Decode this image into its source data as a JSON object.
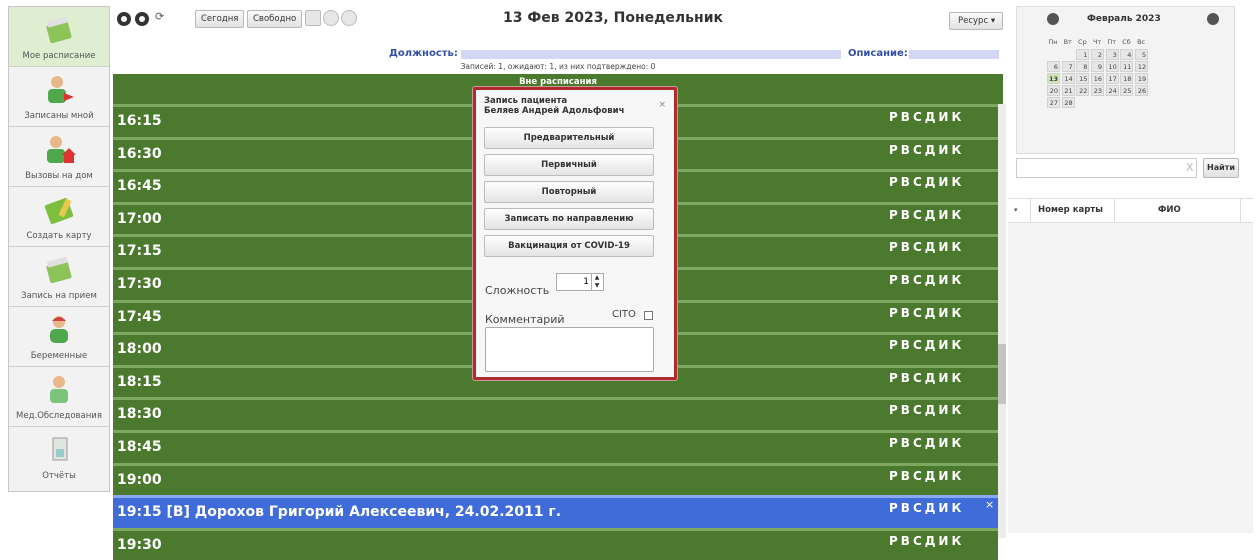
{
  "sidebar": {
    "items": [
      {
        "label": "Мое расписание",
        "icon": "calendar-icon"
      },
      {
        "label": "Записаны мной",
        "icon": "patient-arrow-icon"
      },
      {
        "label": "Вызовы на дом",
        "icon": "house-call-icon"
      },
      {
        "label": "Создать карту",
        "icon": "card-icon"
      },
      {
        "label": "Запись на прием",
        "icon": "calendar-icon"
      },
      {
        "label": "Беременные",
        "icon": "pregnant-icon"
      },
      {
        "label": "Мед.Обследования",
        "icon": "patient-icon"
      },
      {
        "label": "Отчёты",
        "icon": "report-icon"
      }
    ]
  },
  "toolbar": {
    "today_label": "Сегодня",
    "free_label": "Свободно",
    "date_title": "13 Фев 2023, Понедельник",
    "resource_label": "Ресурс"
  },
  "info": {
    "position_label": "Должность:",
    "description_label": "Описание:",
    "summary": "Записей: 1, ожидают: 1, из них подтверждено: 0",
    "outside_schedule": "Вне расписания"
  },
  "schedule": {
    "slot_codes": "РВСДИК",
    "slots": [
      {
        "time": "16:15"
      },
      {
        "time": "16:30"
      },
      {
        "time": "16:45"
      },
      {
        "time": "17:00"
      },
      {
        "time": "17:15"
      },
      {
        "time": "17:30"
      },
      {
        "time": "17:45"
      },
      {
        "time": "18:00"
      },
      {
        "time": "18:15"
      },
      {
        "time": "18:30"
      },
      {
        "time": "18:45"
      },
      {
        "time": "19:00"
      },
      {
        "time": "19:15 [В] Дорохов Григорий Алексеевич, 24.02.2011 г.",
        "booked": true
      },
      {
        "time": "19:30"
      }
    ]
  },
  "dialog": {
    "title_line1": "Запись пациента",
    "title_line2": "Беляев Андрей Адольфович",
    "close": "×",
    "buttons": [
      "Предварительный",
      "Первичный",
      "Повторный",
      "Записать по направлению",
      "Вакцинация от COVID-19"
    ],
    "complexity_label": "Сложность",
    "complexity_value": "1",
    "comment_label": "Комментарий",
    "cito_label": "CITO"
  },
  "calendar": {
    "month": "Февраль 2023",
    "weekdays": [
      "Пн",
      "Вт",
      "Ср",
      "Чт",
      "Пт",
      "Сб",
      "Вс"
    ],
    "weeks": [
      [
        "",
        "",
        "1",
        "2",
        "3",
        "4",
        "5"
      ],
      [
        "6",
        "7",
        "8",
        "9",
        "10",
        "11",
        "12"
      ],
      [
        "13",
        "14",
        "15",
        "16",
        "17",
        "18",
        "19"
      ],
      [
        "20",
        "21",
        "22",
        "23",
        "24",
        "25",
        "26"
      ],
      [
        "27",
        "28",
        "",
        "",
        "",
        "",
        ""
      ]
    ],
    "selected_day": "13"
  },
  "search": {
    "button_label": "Найти",
    "clear": "X"
  },
  "results": {
    "col_card": "Номер карты",
    "col_fio": "ФИО"
  }
}
